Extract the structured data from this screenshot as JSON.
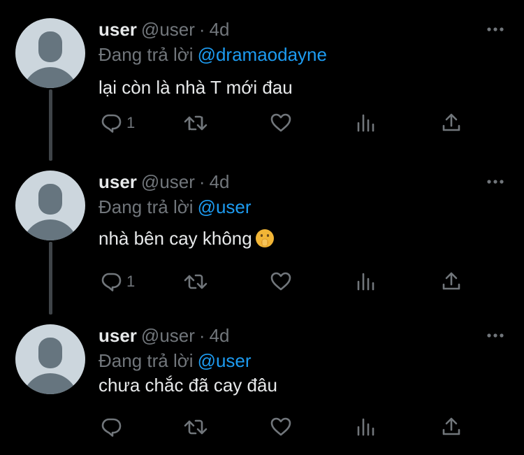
{
  "tweets": [
    {
      "name": "user",
      "handle": "@user",
      "separator": "·",
      "time": "4d",
      "reply_prefix": "Đang trả lời",
      "reply_to": "@dramaodayne",
      "text": "lại còn là nhà T mới đau",
      "emoji": "",
      "reply_count": "1"
    },
    {
      "name": "user",
      "handle": "@user",
      "separator": "·",
      "time": "4d",
      "reply_prefix": "Đang trả lời",
      "reply_to": "@user",
      "text": "nhà bên cay không",
      "emoji": "shushing-face-emoji",
      "reply_count": "1"
    },
    {
      "name": "user",
      "handle": "@user",
      "separator": "·",
      "time": "4d",
      "reply_prefix": "Đang trả lời",
      "reply_to": "@user",
      "text": "chưa chắc đã cay đâu",
      "emoji": "",
      "reply_count": ""
    }
  ],
  "colors": {
    "background": "#000000",
    "text_primary": "#e7e9ea",
    "text_secondary": "#71767b",
    "mention": "#1d9bf0",
    "thread_line": "#3f4448",
    "avatar_bg": "#ccd6dd",
    "avatar_fg": "#66757f"
  }
}
